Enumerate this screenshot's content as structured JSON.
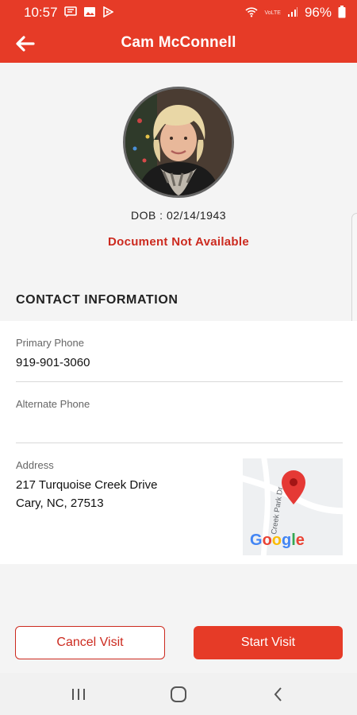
{
  "status_bar": {
    "time": "10:57",
    "signal_text": "VoLTE",
    "battery_percent": "96%",
    "icons": [
      "message-icon",
      "image-icon",
      "play-icon",
      "wifi-icon",
      "signal-icon",
      "battery-icon"
    ]
  },
  "header": {
    "title": "Cam McConnell",
    "back_icon": "back-arrow-icon"
  },
  "profile": {
    "dob": "DOB : 02/14/1943",
    "document_status": "Document Not Available"
  },
  "contact": {
    "heading": "CONTACT INFORMATION",
    "primary_phone_label": "Primary Phone",
    "primary_phone": "919-901-3060",
    "alternate_phone_label": "Alternate Phone",
    "alternate_phone": "",
    "address_label": "Address",
    "address_line1": "217 Turquoise Creek Drive",
    "address_line2": "Cary, NC, 27513",
    "map": {
      "street_label": "Creek Park Dr",
      "attribution": "Google"
    }
  },
  "actions": {
    "cancel_label": "Cancel Visit",
    "start_label": "Start Visit"
  },
  "colors": {
    "brand": "#e63b27",
    "alert_text": "#cc2a1f"
  }
}
